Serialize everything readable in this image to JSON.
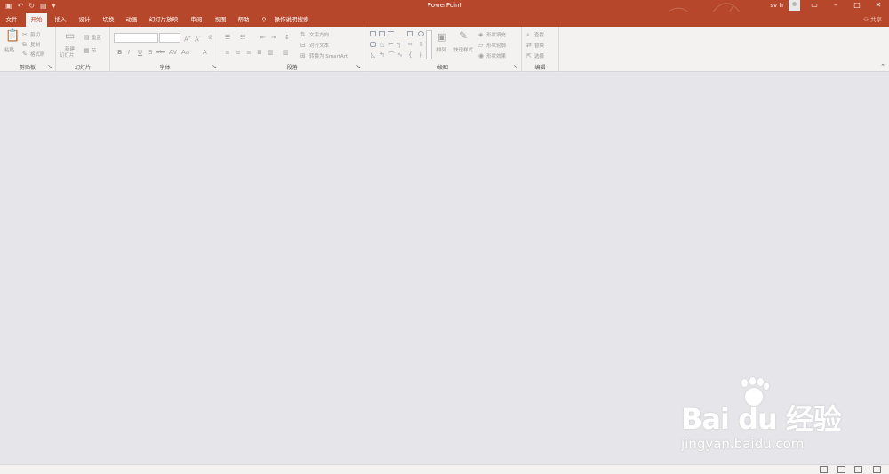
{
  "titlebar": {
    "app_title": "PowerPoint",
    "user_name": "sv tr",
    "qat_icons": [
      "save-icon",
      "undo-icon",
      "redo-icon",
      "present-icon",
      "customize-icon"
    ],
    "window_controls": [
      "ribbon-display-icon",
      "minimize-icon",
      "maximize-icon",
      "close-icon"
    ]
  },
  "tabs": {
    "file": "文件",
    "home": "开始",
    "insert": "插入",
    "design": "设计",
    "transitions": "切换",
    "animations": "动画",
    "slideshow": "幻灯片放映",
    "review": "审阅",
    "view": "视图",
    "help": "帮助",
    "tell_me": "操作说明搜索",
    "share": "共享"
  },
  "ribbon": {
    "clipboard": {
      "label": "剪贴板",
      "paste": "粘贴",
      "cut": "剪切",
      "copy": "复制",
      "format_painter": "格式刷"
    },
    "slides": {
      "label": "幻灯片",
      "new_slide_1": "新建",
      "new_slide_2": "幻灯片",
      "reset": "重置",
      "section": "节"
    },
    "font": {
      "label": "字体",
      "font_name": "",
      "font_size": ""
    },
    "paragraph": {
      "label": "段落",
      "text_direction": "文字方向",
      "align_text": "对齐文本",
      "convert_smartart": "转换为 SmartArt"
    },
    "drawing": {
      "label": "绘图",
      "arrange": "排列",
      "quick_styles": "快速样式",
      "shape_fill": "形状填充",
      "shape_outline": "形状轮廓",
      "shape_effects": "形状效果"
    },
    "editing": {
      "label": "编辑",
      "find": "查找",
      "replace": "替换",
      "select": "选择"
    }
  },
  "watermark": {
    "logo": "Bai du 经验",
    "url": "jingyan.baidu.com"
  },
  "colors": {
    "accent": "#b7472a",
    "ribbon_bg": "#f3f2f1",
    "workspace_bg": "#e6e5e9"
  }
}
